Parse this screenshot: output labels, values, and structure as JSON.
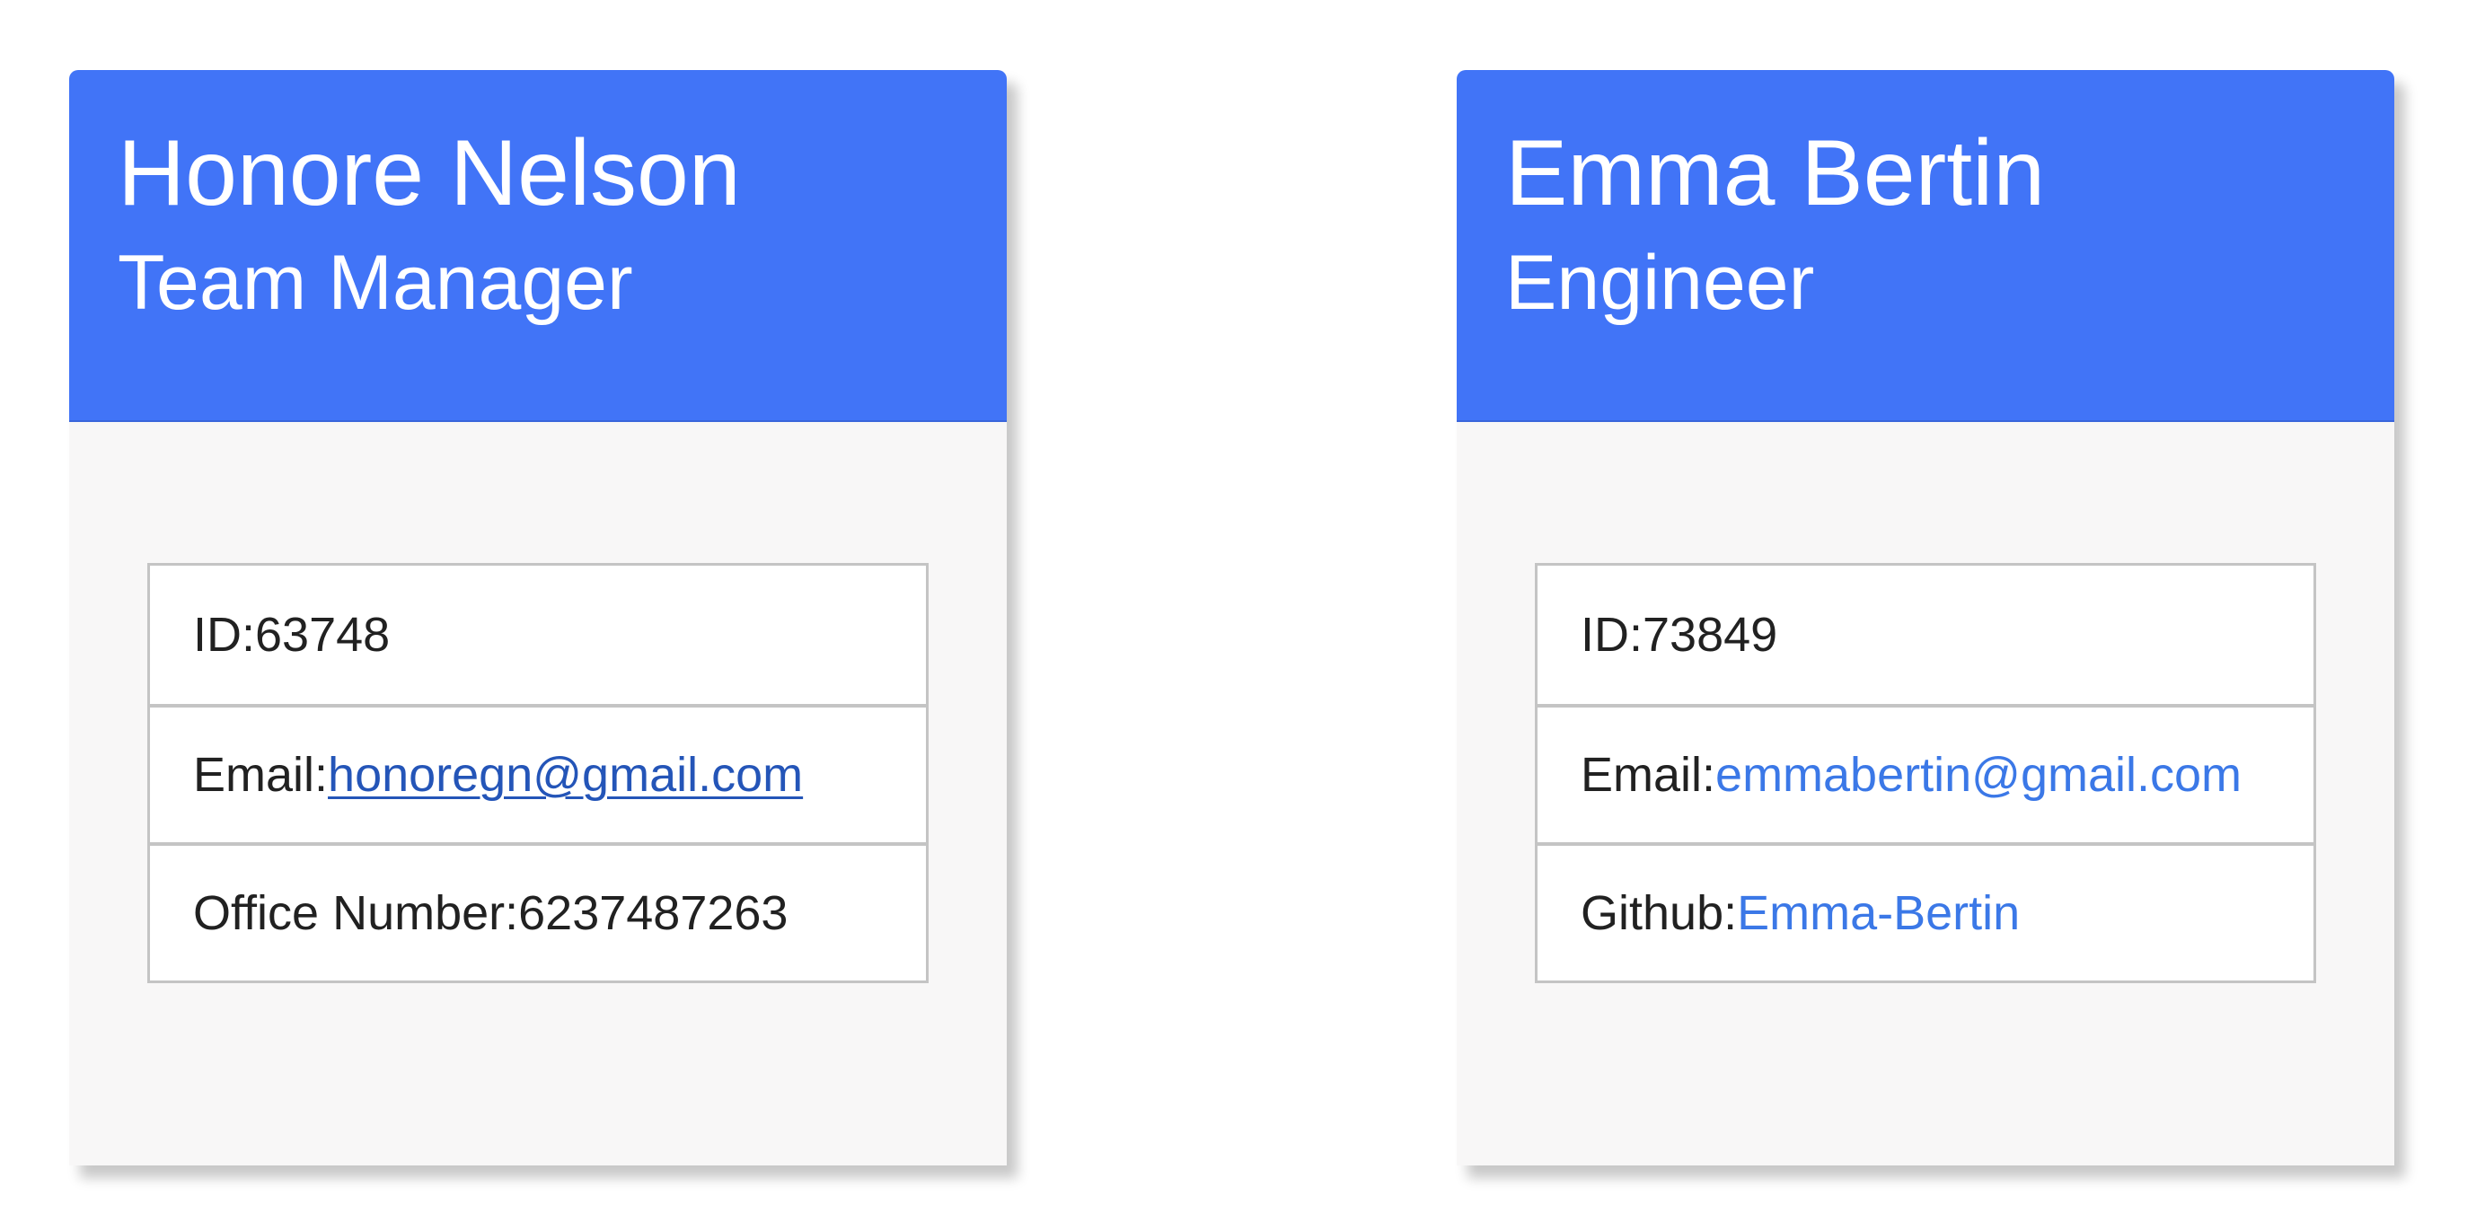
{
  "colors": {
    "header_blue": "#4174f7",
    "card_body": "#f8f7f7",
    "link_visited": "#2455b8",
    "link": "#3b78e7"
  },
  "cards": [
    {
      "name": "Honore Nelson",
      "role": "Team Manager",
      "id_label": "ID:",
      "id_value": "63748",
      "email_label": "Email:",
      "email": "honoregn@gmail.com",
      "extra_label": "Office Number: ",
      "extra_value": "6237487263"
    },
    {
      "name": "Emma Bertin",
      "role": "Engineer",
      "id_label": "ID:",
      "id_value": "73849",
      "email_label": "Email:",
      "email": "emmabertin@gmail.com",
      "extra_label": "Github: ",
      "extra_value": "Emma-Bertin"
    }
  ]
}
